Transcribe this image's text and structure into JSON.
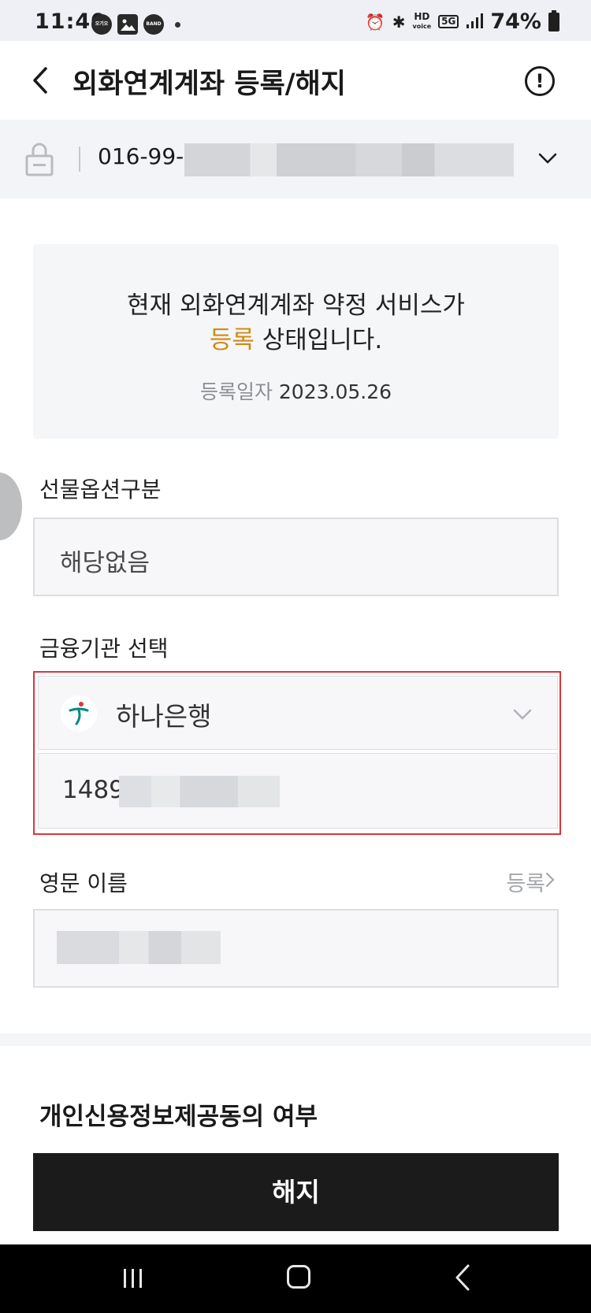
{
  "status_bar": {
    "time": "11:40",
    "notifications": [
      "오기오",
      "gallery",
      "BAND"
    ],
    "icons": [
      "alarm-icon",
      "bluetooth-icon",
      "hd-voice-icon",
      "5g-icon",
      "signal-icon"
    ],
    "hd_label": "HD",
    "voice_label": "voice",
    "network_label": "5G",
    "battery": "74%"
  },
  "header": {
    "title": "외화연계계좌 등록/해지",
    "info_icon": "!"
  },
  "account": {
    "number_prefix": "016-99-("
  },
  "status_card": {
    "line1": "현재 외화연계계좌 약정 서비스가",
    "line2_accent": "등록",
    "line2_rest": " 상태입니다.",
    "date_label": "등록일자",
    "date_value": "2023.05.26"
  },
  "futures_option": {
    "label": "선물옵션구분",
    "value": "해당없음"
  },
  "bank": {
    "label": "금융기관 선택",
    "selected": "하나은행",
    "account_prefix": "1489"
  },
  "english_name": {
    "label": "영문 이름",
    "register_link": "등록"
  },
  "consent": {
    "title": "개인신용정보제공동의 여부"
  },
  "actions": {
    "cancel_label": "해지"
  },
  "colors": {
    "accent": "#d08a17",
    "error_border": "#d9363e",
    "button_bg": "#1b1b1b"
  }
}
